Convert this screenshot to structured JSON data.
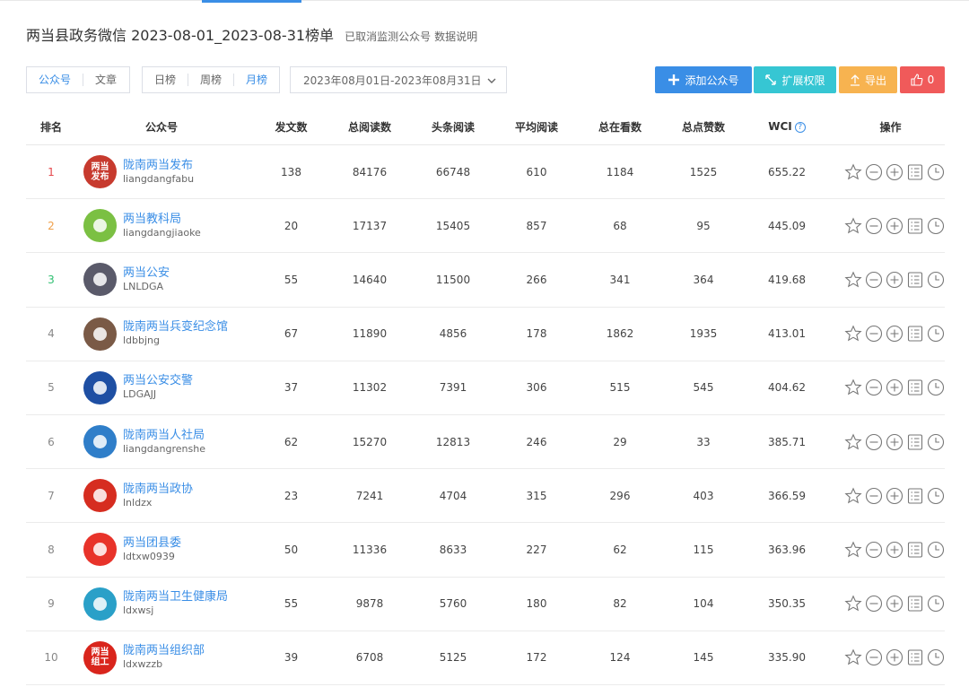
{
  "page": {
    "title": "两当县政务微信 2023-08-01_2023-08-31榜单",
    "links": [
      "已取消监测公众号",
      "数据说明"
    ]
  },
  "toolbar": {
    "type_tabs": [
      "公众号",
      "文章"
    ],
    "period_tabs": [
      "日榜",
      "周榜",
      "月榜"
    ],
    "date_range": "2023年08月01日-2023年08月31日",
    "add_label": "添加公众号",
    "expand_label": "扩展权限",
    "export_label": "导出",
    "like_count": "0"
  },
  "table": {
    "headers": {
      "rank": "排名",
      "account": "公众号",
      "posts": "发文数",
      "total_reads": "总阅读数",
      "headline_reads": "头条阅读",
      "avg_reads": "平均阅读",
      "total_watching": "总在看数",
      "total_likes": "总点赞数",
      "wci": "WCI",
      "ops": "操作"
    },
    "rows": [
      {
        "rank": "1",
        "name": "陇南两当发布",
        "id": "liangdangfabu",
        "posts": "138",
        "total_reads": "84176",
        "headline_reads": "66748",
        "avg_reads": "610",
        "watching": "1184",
        "likes": "1525",
        "wci": "655.22",
        "avatar_text": "两当发布",
        "avatar_color": "#c73a2e"
      },
      {
        "rank": "2",
        "name": "两当教科局",
        "id": "liangdangjiaoke",
        "posts": "20",
        "total_reads": "17137",
        "headline_reads": "15405",
        "avg_reads": "857",
        "watching": "68",
        "likes": "95",
        "wci": "445.09",
        "avatar_text": "",
        "avatar_color": "#7bc043"
      },
      {
        "rank": "3",
        "name": "两当公安",
        "id": "LNLDGA",
        "posts": "55",
        "total_reads": "14640",
        "headline_reads": "11500",
        "avg_reads": "266",
        "watching": "341",
        "likes": "364",
        "wci": "419.68",
        "avatar_text": "",
        "avatar_color": "#5a5a6a"
      },
      {
        "rank": "4",
        "name": "陇南两当兵变纪念馆",
        "id": "ldbbjng",
        "posts": "67",
        "total_reads": "11890",
        "headline_reads": "4856",
        "avg_reads": "178",
        "watching": "1862",
        "likes": "1935",
        "wci": "413.01",
        "avatar_text": "",
        "avatar_color": "#7a5a46"
      },
      {
        "rank": "5",
        "name": "两当公安交警",
        "id": "LDGAJJ",
        "posts": "37",
        "total_reads": "11302",
        "headline_reads": "7391",
        "avg_reads": "306",
        "watching": "515",
        "likes": "545",
        "wci": "404.62",
        "avatar_text": "",
        "avatar_color": "#1e4fa3"
      },
      {
        "rank": "6",
        "name": "陇南两当人社局",
        "id": "liangdangrenshe",
        "posts": "62",
        "total_reads": "15270",
        "headline_reads": "12813",
        "avg_reads": "246",
        "watching": "29",
        "likes": "33",
        "wci": "385.71",
        "avatar_text": "",
        "avatar_color": "#2f7ec9"
      },
      {
        "rank": "7",
        "name": "陇南两当政协",
        "id": "lnldzx",
        "posts": "23",
        "total_reads": "7241",
        "headline_reads": "4704",
        "avg_reads": "315",
        "watching": "296",
        "likes": "403",
        "wci": "366.59",
        "avatar_text": "",
        "avatar_color": "#d62d20"
      },
      {
        "rank": "8",
        "name": "两当团县委",
        "id": "ldtxw0939",
        "posts": "50",
        "total_reads": "11336",
        "headline_reads": "8633",
        "avg_reads": "227",
        "watching": "62",
        "likes": "115",
        "wci": "363.96",
        "avatar_text": "",
        "avatar_color": "#e8332a"
      },
      {
        "rank": "9",
        "name": "陇南两当卫生健康局",
        "id": "ldxwsj",
        "posts": "55",
        "total_reads": "9878",
        "headline_reads": "5760",
        "avg_reads": "180",
        "watching": "82",
        "likes": "104",
        "wci": "350.35",
        "avatar_text": "",
        "avatar_color": "#2aa0c8"
      },
      {
        "rank": "10",
        "name": "陇南两当组织部",
        "id": "ldxwzzb",
        "posts": "39",
        "total_reads": "6708",
        "headline_reads": "5125",
        "avg_reads": "172",
        "watching": "124",
        "likes": "145",
        "wci": "335.90",
        "avatar_text": "两当组工",
        "avatar_color": "#d9251c"
      }
    ]
  },
  "colors": {
    "accent": "#3a8ee6",
    "add_button": "#3a8ee6",
    "expand_button": "#36c6d3",
    "export_button": "#f7b350",
    "like_button": "#f05a5a",
    "rank_1": "#e5484d",
    "rank_2": "#f0a04a",
    "rank_3": "#2fbf71"
  },
  "icons": {
    "row_ops": [
      "star-icon",
      "minus-circle-icon",
      "plus-circle-icon",
      "list-icon",
      "clock-icon"
    ]
  }
}
